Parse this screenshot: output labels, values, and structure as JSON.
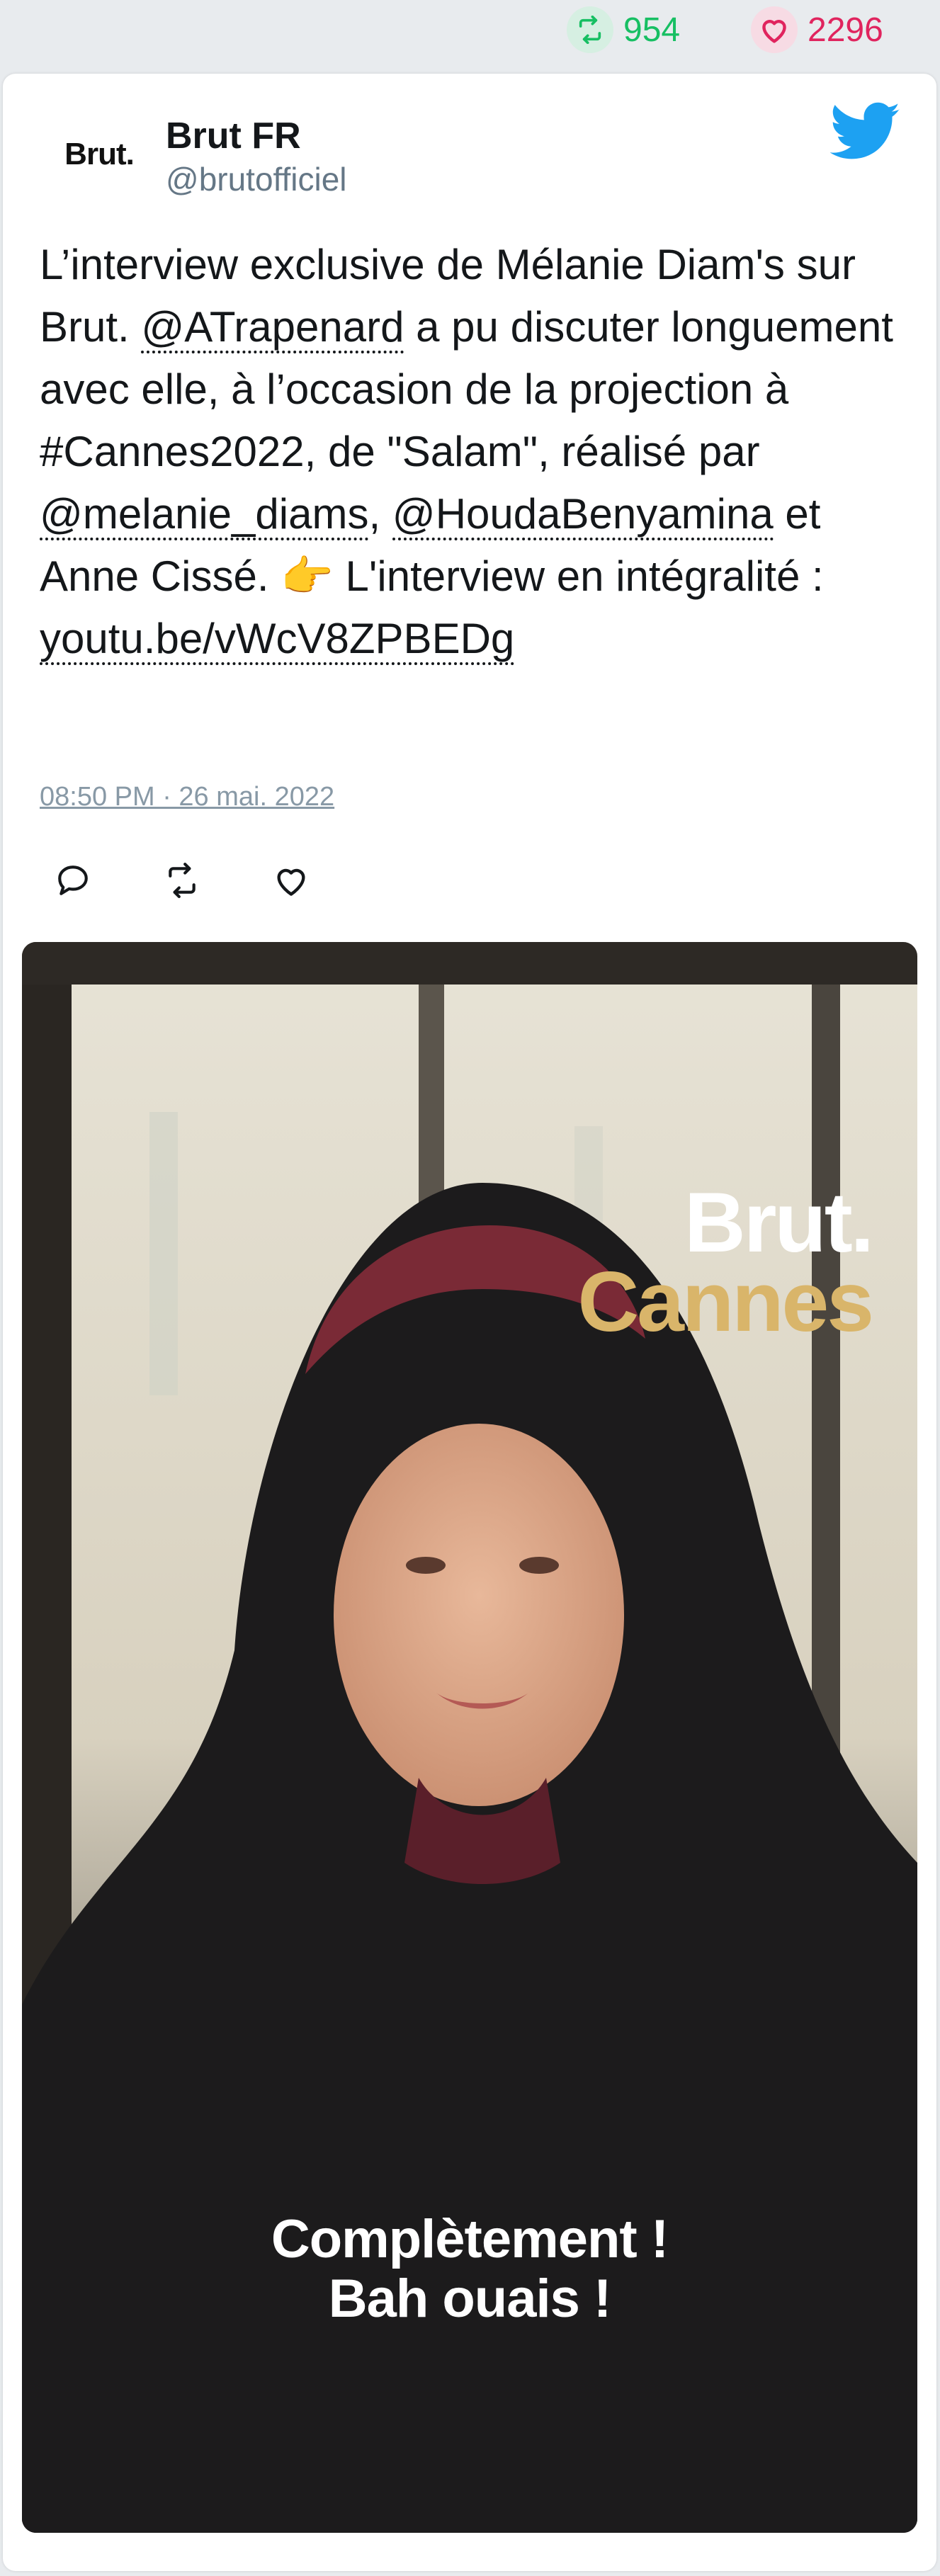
{
  "stats": {
    "retweets": "954",
    "likes": "2296",
    "retweet_color": "#17bf63",
    "like_color": "#e0245e",
    "retweet_icon": "retweet-icon",
    "like_icon": "heart-icon"
  },
  "tweet": {
    "author": {
      "avatar_text": "Brut.",
      "name": "Brut FR",
      "handle": "@brutofficiel"
    },
    "platform_icon": "twitter-bird-icon",
    "platform_color": "#1da1f2",
    "text": {
      "part1": "L’interview exclusive de Mélanie Diam's sur Brut. ",
      "mention1": "@ATrapenard",
      "part2": " a pu discuter longuement avec elle, à l’occasion de la projection à #Cannes2022, de \"Salam\", réalisé par ",
      "mention2": "@melanie_diams",
      "part3": ", ",
      "mention3": "@HoudaBenyamina",
      "part4": " et Anne Cissé. 👉 L'interview en intégralité : ",
      "link": "youtu.be/vWcV8ZPBEDg"
    },
    "timestamp": "08:50 PM · 26 mai. 2022",
    "actions": {
      "reply_icon": "reply-icon",
      "retweet_icon": "retweet-icon",
      "like_icon": "heart-icon"
    },
    "media": {
      "overlay_line1": "Brut.",
      "overlay_line2": "Cannes",
      "subtitle_line1": "Complètement !",
      "subtitle_line2": "Bah ouais !"
    }
  }
}
